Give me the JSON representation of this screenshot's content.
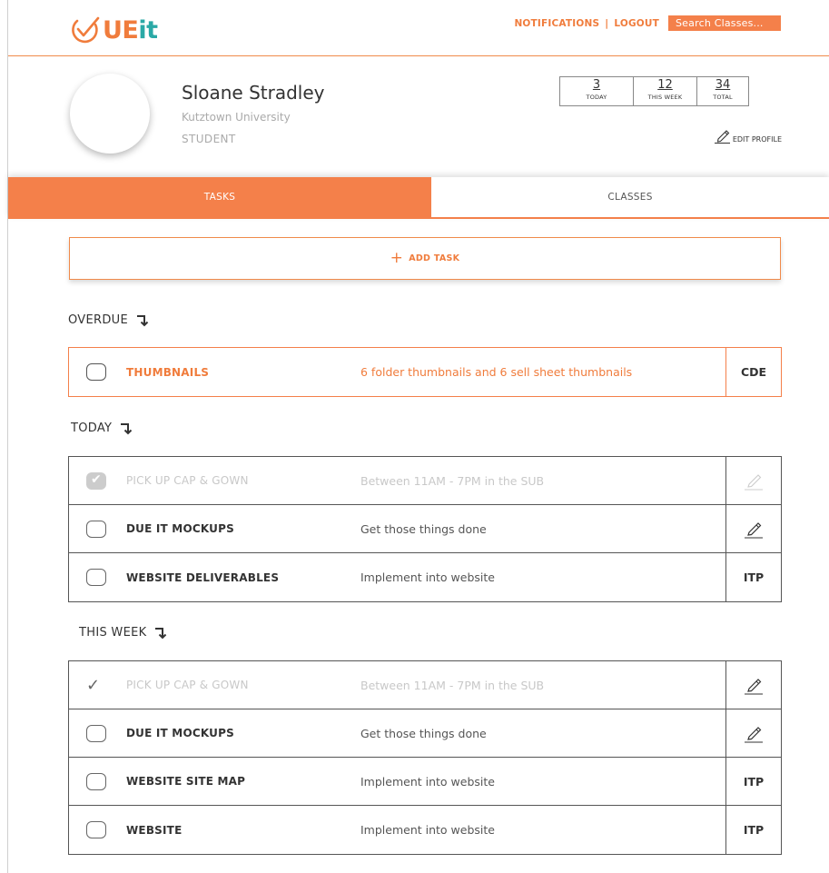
{
  "header": {
    "logo_ue": "UE",
    "logo_it": "it",
    "notifications_label": "NOTIFICATIONS",
    "separator": "|",
    "logout_label": "LOGOUT",
    "search_placeholder": "Search Classes..."
  },
  "profile": {
    "name": "Sloane Stradley",
    "university": "Kutztown University",
    "role": "STUDENT",
    "stats": [
      {
        "value": "3",
        "label": "TODAY"
      },
      {
        "value": "12",
        "label": "THIS WEEK"
      },
      {
        "value": "34",
        "label": "TOTAL"
      }
    ],
    "edit_label": "EDIT PROFILE"
  },
  "tabs": [
    {
      "label": "TASKS",
      "active": true
    },
    {
      "label": "CLASSES",
      "active": false
    }
  ],
  "add_task": {
    "plus": "+",
    "label": "ADD TASK"
  },
  "sections": {
    "overdue": {
      "title": "OVERDUE",
      "tasks": [
        {
          "name": "THUMBNAILS",
          "desc": "6 folder thumbnails and 6 sell sheet thumbnails",
          "action": "CDE"
        }
      ]
    },
    "today": {
      "title": "TODAY",
      "tasks": [
        {
          "name": "PICK UP CAP & GOWN",
          "desc": "Between 11AM - 7PM in the SUB",
          "action": "pencil-icon",
          "done": true
        },
        {
          "name": "DUE IT MOCKUPS",
          "desc": "Get those things done",
          "action": "pencil-icon"
        },
        {
          "name": "WEBSITE DELIVERABLES",
          "desc": "Implement into website",
          "action": "ITP"
        }
      ]
    },
    "this_week": {
      "title": "THIS WEEK",
      "tasks": [
        {
          "name": "PICK UP CAP & GOWN",
          "desc": "Between 11AM - 7PM in the SUB",
          "action": "pencil-icon",
          "done": true
        },
        {
          "name": "DUE IT MOCKUPS",
          "desc": "Get those things done",
          "action": "pencil-icon"
        },
        {
          "name": "WEBSITE SITE MAP",
          "desc": "Implement into website",
          "action": "ITP"
        },
        {
          "name": "WEBSITE",
          "desc": "Implement into website",
          "action": "ITP"
        }
      ]
    }
  },
  "colors": {
    "accent": "#f4804a",
    "teal": "#2aa9a6"
  }
}
